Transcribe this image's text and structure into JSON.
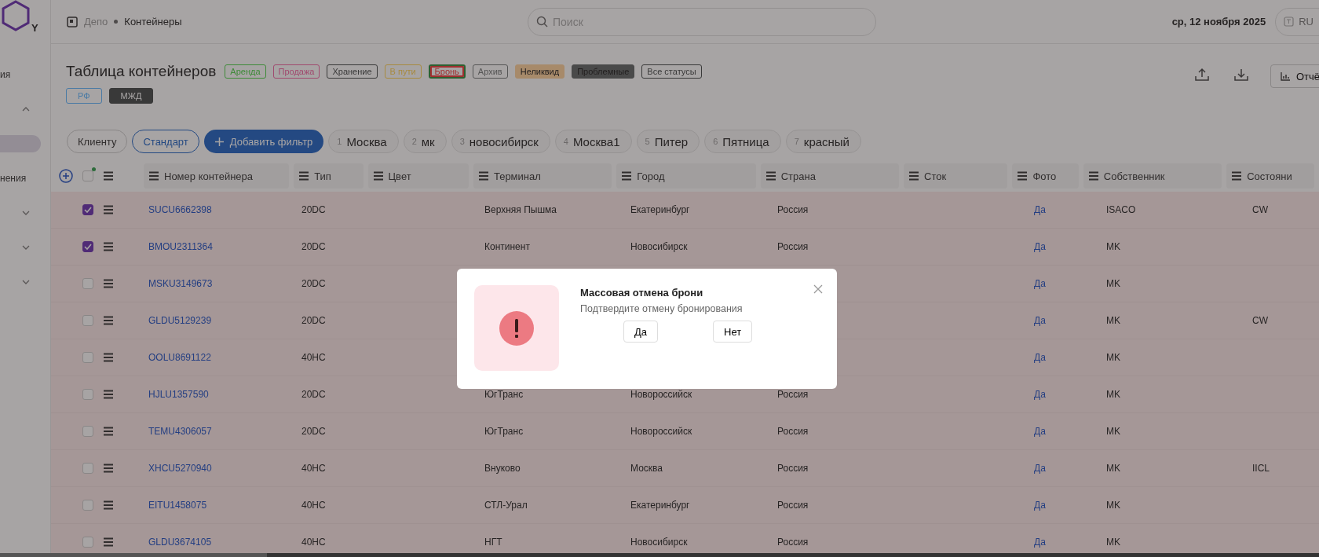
{
  "sidebar": {
    "logo_letter": "Y",
    "items": [
      {
        "kind": "text",
        "label": "ия"
      },
      {
        "kind": "chevron",
        "expanded": true
      },
      {
        "kind": "pill",
        "selected": true
      },
      {
        "kind": "text",
        "label": "нения"
      },
      {
        "kind": "chevron",
        "expanded": false
      },
      {
        "kind": "chevron",
        "expanded": false
      },
      {
        "kind": "chevron",
        "expanded": false
      }
    ]
  },
  "topbar": {
    "breadcrumb": [
      "Депо",
      "Контейнеры"
    ],
    "search": {
      "placeholder": "Поиск"
    },
    "date": "ср, 12 ноября 2025",
    "language": "RU"
  },
  "header": {
    "title": "Таблица контейнеров",
    "status_tags": [
      {
        "label": "Аренда",
        "color": "#3f8a3a",
        "kind": "outline",
        "selected": false
      },
      {
        "label": "Продажа",
        "color": "#a04a6e",
        "kind": "outline",
        "selected": false
      },
      {
        "label": "Хранение",
        "color": "#3a3a3a",
        "kind": "outline",
        "selected": false
      },
      {
        "label": "В пути",
        "color": "#a88a40",
        "kind": "outline",
        "selected": false
      },
      {
        "label": "Бронь",
        "color": "#a03030",
        "kind": "outline",
        "selected": true
      },
      {
        "label": "Архив",
        "color": "#555555",
        "kind": "outline",
        "selected": false
      },
      {
        "label": "Неликвид",
        "color": "#a88a6a",
        "kind": "filled",
        "selected": false
      },
      {
        "label": "Проблемные",
        "color": "#4a4a4a",
        "kind": "filled",
        "selected": false
      },
      {
        "label": "Все статусы",
        "color": "#3a3a3a",
        "kind": "outline",
        "selected": false
      }
    ],
    "region_tags": [
      {
        "label": "РФ",
        "color": "#4a7aa8",
        "kind": "outline"
      },
      {
        "label": "МЖД",
        "color": "#3a3a3a",
        "kind": "filled"
      }
    ],
    "report_button": "Отчё"
  },
  "filters": {
    "presets": [
      {
        "label": "Клиенту",
        "selected": false
      },
      {
        "label": "Стандарт",
        "selected": true
      }
    ],
    "add_button": "Добавить фильтр",
    "saved": [
      {
        "number": "1",
        "label": "Москва"
      },
      {
        "number": "2",
        "label": "мк"
      },
      {
        "number": "3",
        "label": "новосибирск"
      },
      {
        "number": "4",
        "label": "Москва1"
      },
      {
        "number": "5",
        "label": "Питер"
      },
      {
        "number": "6",
        "label": "Пятница"
      },
      {
        "number": "7",
        "label": "красный"
      }
    ]
  },
  "table": {
    "select_all": {
      "checked": false
    },
    "columns": [
      "Номер контейнера",
      "Тип",
      "Цвет",
      "Терминал",
      "Город",
      "Страна",
      "Сток",
      "Фото",
      "Собственник",
      "Состояни"
    ],
    "rows": [
      {
        "checked": true,
        "container": "SUCU6662398",
        "type": "20DC",
        "terminal": "Верхняя Пышма",
        "city": "Екатеринбург",
        "country": "Россия",
        "photo": "Да",
        "owner": "ISACO",
        "state": "CW"
      },
      {
        "checked": true,
        "container": "BMOU2311364",
        "type": "20DC",
        "terminal": "Континент",
        "city": "Новосибирск",
        "country": "Россия",
        "photo": "Да",
        "owner": "MK"
      },
      {
        "checked": false,
        "container": "MSKU3149673",
        "type": "20DC",
        "photo": "Да",
        "owner": "MK"
      },
      {
        "checked": false,
        "container": "GLDU5129239",
        "type": "20DC",
        "photo": "Да",
        "owner": "MK",
        "state": "CW"
      },
      {
        "checked": false,
        "container": "OOLU8691122",
        "type": "40HC",
        "photo": "Да",
        "owner": "MK"
      },
      {
        "checked": false,
        "container": "HJLU1357590",
        "type": "20DC",
        "terminal": "ЮгТранс",
        "city": "Новороссийск",
        "country": "Россия",
        "photo": "Да",
        "owner": "MK"
      },
      {
        "checked": false,
        "container": "TEMU4306057",
        "type": "20DC",
        "terminal": "ЮгТранс",
        "city": "Новороссийск",
        "country": "Россия",
        "photo": "Да",
        "owner": "MK"
      },
      {
        "checked": false,
        "container": "XHCU5270940",
        "type": "40HC",
        "terminal": "Внуково",
        "city": "Москва",
        "country": "Россия",
        "photo": "Да",
        "owner": "MK",
        "state": "IICL"
      },
      {
        "checked": false,
        "container": "EITU1458075",
        "type": "40HC",
        "terminal": "СТЛ-Урал",
        "city": "Екатеринбург",
        "country": "Россия",
        "photo": "Да",
        "owner": "MK"
      },
      {
        "checked": false,
        "container": "GLDU3674105",
        "type": "40HC",
        "terminal": "НГТ",
        "city": "Новосибирск",
        "country": "Россия",
        "photo": "Да",
        "owner": "MK"
      }
    ]
  },
  "dialog": {
    "title": "Массовая отмена брони",
    "message": "Подтвердите отмену бронирования",
    "buttons": [
      "Да",
      "Нет"
    ]
  }
}
